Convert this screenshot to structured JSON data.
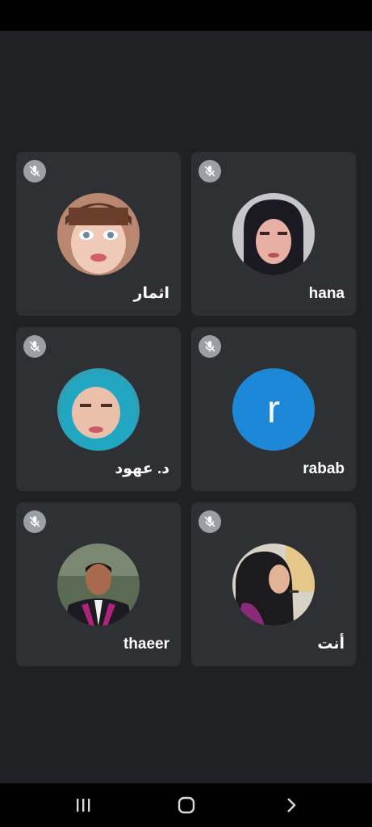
{
  "participants": [
    {
      "name": "اثمار",
      "muted": true,
      "avatar_type": "photo",
      "avatar_desc": "child-photo"
    },
    {
      "name": "hana",
      "muted": true,
      "avatar_type": "photo",
      "avatar_desc": "woman-black-hijab-photo"
    },
    {
      "name": "د. عهود",
      "muted": true,
      "avatar_type": "photo",
      "avatar_desc": "woman-blue-hijab-photo"
    },
    {
      "name": "rabab",
      "muted": true,
      "avatar_type": "letter",
      "avatar_letter": "r",
      "avatar_color": "#1e88d8"
    },
    {
      "name": "thaeer",
      "muted": true,
      "avatar_type": "photo",
      "avatar_desc": "man-graduation-photo"
    },
    {
      "name": "أنت",
      "muted": true,
      "avatar_type": "photo",
      "avatar_desc": "woman-graduation-photo"
    }
  ],
  "icons": {
    "mute": "mic-off-icon",
    "nav_recents": "recents-icon",
    "nav_home": "home-icon",
    "nav_back": "back-icon"
  },
  "colors": {
    "background": "#202124",
    "tile": "#2f3034",
    "mute_badge": "#9aa0a6",
    "letter_avatar": "#1e88d8"
  }
}
